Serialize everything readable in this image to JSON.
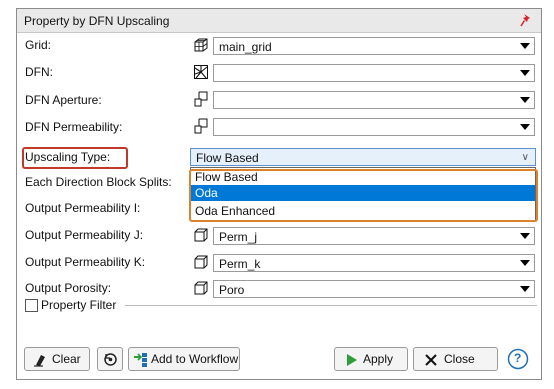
{
  "title": "Property by DFN Upscaling",
  "rows": [
    {
      "label": "Grid:",
      "value": "main_grid",
      "icon": "grid-cube-icon"
    },
    {
      "label": "DFN:",
      "value": "",
      "icon": "dfn-fracture-icon"
    },
    {
      "label": "DFN Aperture:",
      "value": "",
      "icon": "property-icon"
    },
    {
      "label": "DFN Permeability:",
      "value": "",
      "icon": "property-icon"
    }
  ],
  "upscaling": {
    "label": "Upscaling Type:",
    "value": "Flow Based"
  },
  "dropdown_options": [
    "Flow Based",
    "Oda",
    "Oda Enhanced"
  ],
  "selected_option": "Oda",
  "each_direction_label": "Each Direction Block Splits:",
  "outputs": [
    {
      "label": "Output Permeability I:",
      "value": ""
    },
    {
      "label": "Output Permeability J:",
      "value": "Perm_j"
    },
    {
      "label": "Output Permeability K:",
      "value": "Perm_k"
    },
    {
      "label": "Output Porosity:",
      "value": "Poro"
    }
  ],
  "property_filter": {
    "label": "Property Filter",
    "checked": false
  },
  "buttons": {
    "clear": "Clear",
    "add_to_workflow": "Add to Workflow",
    "apply": "Apply",
    "close": "Close",
    "help": "?"
  },
  "colors": {
    "selection": "#0078d7",
    "label_highlight": "#c0392b",
    "dropdown_highlight": "#d9832f",
    "apply_arrow": "#2e9e3a",
    "pin": "#d6212a"
  }
}
